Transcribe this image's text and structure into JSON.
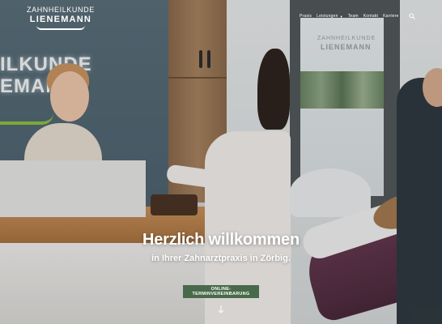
{
  "header": {
    "logo": {
      "line1": "ZAHNHEILKUNDE",
      "line2": "LIENEMANN"
    },
    "nav": [
      {
        "label": "Praxis",
        "has_dropdown": false
      },
      {
        "label": "Leistungen",
        "has_dropdown": true
      },
      {
        "label": "Team",
        "has_dropdown": false
      },
      {
        "label": "Kontakt",
        "has_dropdown": false
      },
      {
        "label": "Karriere",
        "has_dropdown": false
      }
    ],
    "search_icon": "search-icon"
  },
  "hero": {
    "wall_sign": {
      "line1": "ILKUNDE",
      "line2": "EMAN"
    },
    "door_logo": {
      "line1": "ZAHNHEILKUNDE",
      "line2": "LIENEMANN"
    },
    "title": "Herzlich willkommen",
    "subtitle": "in Ihrer Zahnarztpraxis in Zörbig.",
    "cta_label": "ONLINE-TERMINVEREINBARUNG",
    "scroll_icon": "arrow-down-icon"
  },
  "colors": {
    "cta_background": "#486a4a",
    "text": "#ffffff",
    "accent_green": "#8dc13f"
  }
}
